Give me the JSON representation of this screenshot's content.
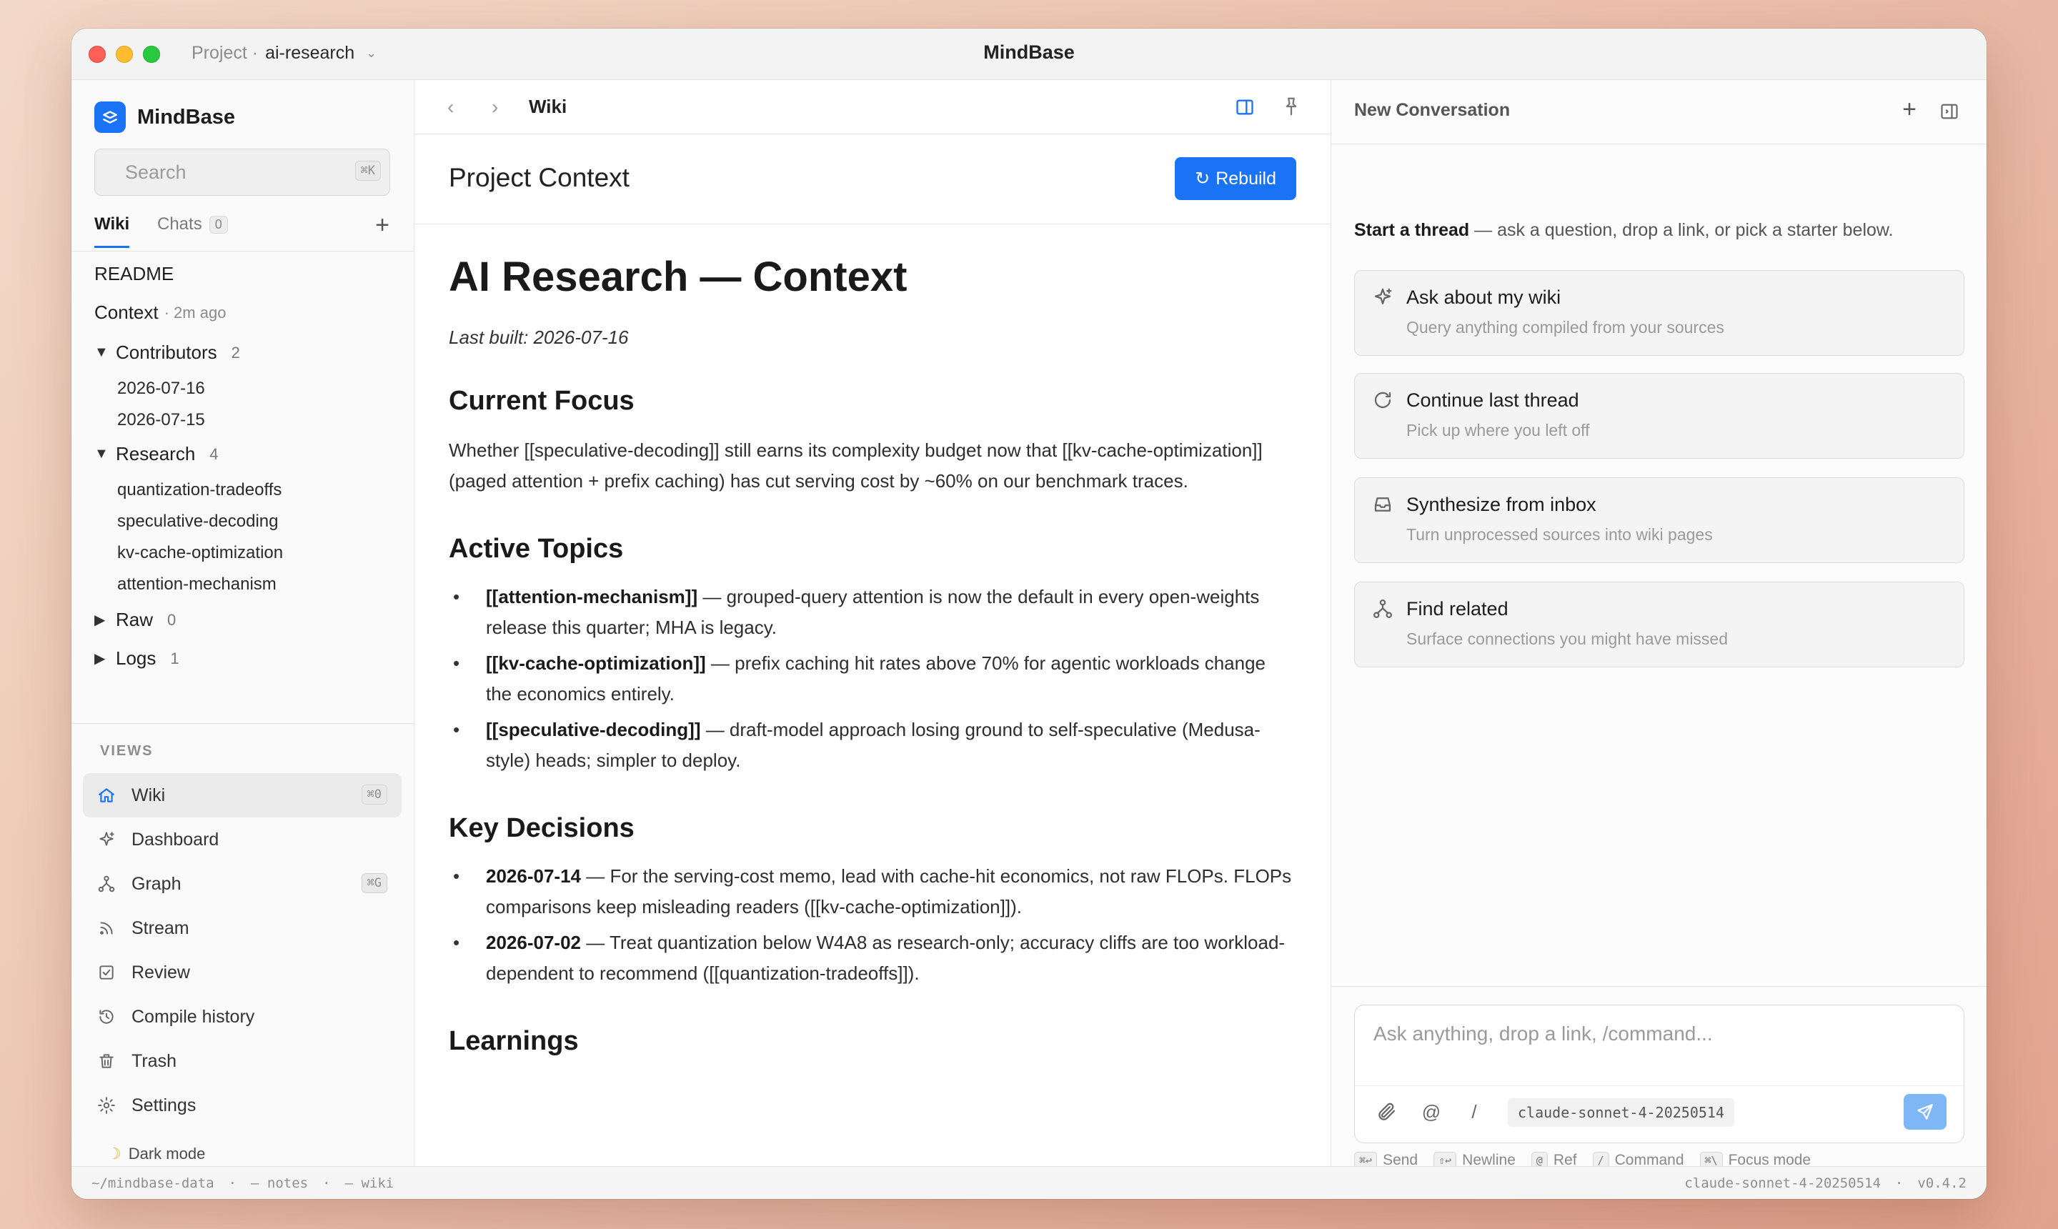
{
  "window": {
    "title": "MindBase",
    "breadcrumb_prefix": "Project ·",
    "project": "ai-research"
  },
  "sidebar": {
    "brand": "MindBase",
    "search": {
      "placeholder": "Search",
      "shortcut": "⌘K"
    },
    "tabs": [
      {
        "label": "Wiki",
        "active": true
      },
      {
        "label": "Chats",
        "count": "0"
      }
    ],
    "tree": {
      "readme": "README",
      "context": {
        "label": "Context",
        "meta": "· 2m ago"
      },
      "contributors": {
        "label": "Contributors",
        "count": "2",
        "children": [
          "2026-07-16",
          "2026-07-15"
        ]
      },
      "research": {
        "label": "Research",
        "count": "4",
        "children": [
          "quantization-tradeoffs",
          "speculative-decoding",
          "kv-cache-optimization",
          "attention-mechanism"
        ]
      },
      "raw": {
        "label": "Raw",
        "count": "0"
      },
      "logs": {
        "label": "Logs",
        "count": "1"
      }
    },
    "views_label": "VIEWS",
    "views": [
      {
        "label": "Wiki",
        "icon": "home-icon",
        "shortcut": "⌘0",
        "active": true
      },
      {
        "label": "Dashboard",
        "icon": "sparkle-icon"
      },
      {
        "label": "Graph",
        "icon": "graph-icon",
        "shortcut": "⌘G"
      },
      {
        "label": "Stream",
        "icon": "rss-icon"
      },
      {
        "label": "Review",
        "icon": "checkbox-icon"
      },
      {
        "label": "Compile history",
        "icon": "history-icon"
      },
      {
        "label": "Trash",
        "icon": "trash-icon"
      },
      {
        "label": "Settings",
        "icon": "gear-icon"
      }
    ],
    "dark_mode": "Dark mode"
  },
  "center": {
    "nav_title": "Wiki",
    "page_title": "Project Context",
    "rebuild_label": "Rebuild",
    "doc": {
      "h1": "AI Research — Context",
      "built": "Last built: 2026-07-16",
      "focus_heading": "Current Focus",
      "focus_text": "Whether [[speculative-decoding]] still earns its complexity budget now that [[kv-cache-optimization]] (paged attention + prefix caching) has cut serving cost by ~60% on our benchmark traces.",
      "topics_heading": "Active Topics",
      "topics": [
        {
          "tag": "[[attention-mechanism]]",
          "text": " — grouped-query attention is now the default in every open-weights release this quarter; MHA is legacy."
        },
        {
          "tag": "[[kv-cache-optimization]]",
          "text": " — prefix caching hit rates above 70% for agentic workloads change the economics entirely."
        },
        {
          "tag": "[[speculative-decoding]]",
          "text": " — draft-model approach losing ground to self-speculative (Medusa-style) heads; simpler to deploy."
        }
      ],
      "decisions_heading": "Key Decisions",
      "decisions": [
        {
          "date": "2026-07-14",
          "text": " — For the serving-cost memo, lead with cache-hit economics, not raw FLOPs. FLOPs comparisons keep misleading readers ([[kv-cache-optimization]])."
        },
        {
          "date": "2026-07-02",
          "text": " — Treat quantization below W4A8 as research-only; accuracy cliffs are too workload-dependent to recommend ([[quantization-tradeoffs]])."
        }
      ],
      "learnings_heading": "Learnings"
    }
  },
  "right": {
    "title": "New Conversation",
    "intro_bold": "Start a thread",
    "intro_rest": " — ask a question, drop a link, or pick a starter below.",
    "starters": [
      {
        "title": "Ask about my wiki",
        "subtitle": "Query anything compiled from your sources",
        "icon": "sparkle-icon"
      },
      {
        "title": "Continue last thread",
        "subtitle": "Pick up where you left off",
        "icon": "refresh-icon"
      },
      {
        "title": "Synthesize from inbox",
        "subtitle": "Turn unprocessed sources into wiki pages",
        "icon": "inbox-icon"
      },
      {
        "title": "Find related",
        "subtitle": "Surface connections you might have missed",
        "icon": "graph-icon"
      }
    ],
    "composer": {
      "placeholder": "Ask anything, drop a link, /command...",
      "model": "claude-sonnet-4-20250514"
    },
    "hints": [
      {
        "key": "⌘↩",
        "label": "Send"
      },
      {
        "key": "⇧↩",
        "label": "Newline"
      },
      {
        "key": "@",
        "label": "Ref"
      },
      {
        "key": "/",
        "label": "Command"
      },
      {
        "key": "⌘\\",
        "label": "Focus mode"
      }
    ]
  },
  "footer": {
    "path": "~/mindbase-data",
    "notes": "— notes",
    "wiki": "— wiki",
    "sep": "·",
    "model": "claude-sonnet-4-20250514",
    "version": "v0.4.2"
  },
  "colors": {
    "accent": "#1a73f5",
    "send_button": "#7fb6f5"
  }
}
